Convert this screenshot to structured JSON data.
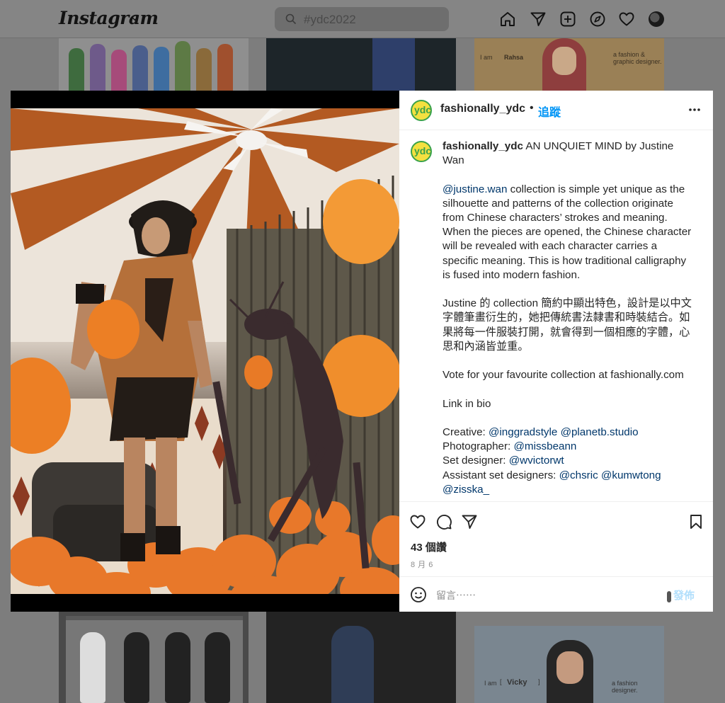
{
  "nav": {
    "logo": "Instagram",
    "search_value": "#ydc2022",
    "icons": [
      "home-icon",
      "direct-icon",
      "new-post-icon",
      "explore-icon",
      "activity-heart-icon",
      "profile-avatar"
    ]
  },
  "grid": {
    "tile_c_texts": [
      "I am",
      "Rahsa",
      "a fashion &",
      "graphic designer."
    ],
    "tile_f_texts": [
      "I am",
      "[",
      "Vicky",
      "]",
      "a fashion designer."
    ]
  },
  "post": {
    "username": "fashionally_ydc",
    "dot": "•",
    "follow_label": "追蹤",
    "caption": {
      "username": "fashionally_ydc",
      "line1": "AN UNQUIET MIND by Justine Wan",
      "p2_mention": "@justine.wan",
      "p2_text": "collection is simple yet unique as the silhouette and patterns of the collection originate from Chinese characters’ strokes and meaning. When the pieces are opened, the Chinese character will be revealed with each character carries a specific meaning. This is how traditional calligraphy is fused into modern fashion.",
      "p3": "Justine 的 collection 簡約中顯出特色，設計是以中文字體筆畫衍生的，她把傳統書法隸書和時裝結合。如果將每一件服裝打開，就會得到一個相應的字體，心思和內涵皆並重。",
      "p4": "Vote for your favourite collection at fashionally.com",
      "p5": "Link in bio",
      "credits": [
        {
          "label": "Creative:",
          "mentions": [
            "@inggradstyle",
            "@planetb.studio"
          ]
        },
        {
          "label": "Photographer:",
          "mentions": [
            "@missbeann"
          ]
        },
        {
          "label": "Set designer:",
          "mentions": [
            "@wvictorwt"
          ]
        },
        {
          "label": "Assistant set designers:",
          "mentions": [
            "@chsric",
            "@kumwtong",
            "@zisska_"
          ]
        }
      ]
    },
    "likes": "43 個讚",
    "date": "8 月 6",
    "comment_placeholder": "留言⋯⋯",
    "post_label": "發佈"
  },
  "colors": {
    "follow_blue": "#0095f6",
    "mention_blue": "#00376b",
    "post_disabled": "#b2dffc",
    "balloon_orange": "#f08a26"
  }
}
